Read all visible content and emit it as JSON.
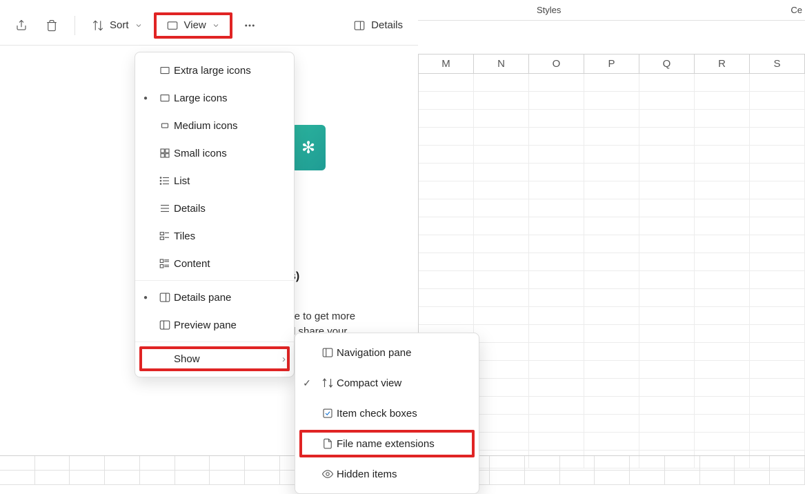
{
  "ribbon": {
    "styles_label": "Styles",
    "cells_label": "Ce"
  },
  "spreadsheet": {
    "columns": [
      "M",
      "N",
      "O",
      "P",
      "Q",
      "R",
      "S"
    ]
  },
  "toolbar": {
    "sort_label": "Sort",
    "view_label": "View",
    "details_label": "Details"
  },
  "background": {
    "filename_suffix": "s)",
    "hint_line1": "ile to get more",
    "hint_line2": "d share your"
  },
  "view_menu": {
    "items": [
      {
        "label": "Extra large icons",
        "icon": "rect",
        "selected": false
      },
      {
        "label": "Large icons",
        "icon": "rect",
        "selected": true
      },
      {
        "label": "Medium icons",
        "icon": "rect-sm",
        "selected": false
      },
      {
        "label": "Small icons",
        "icon": "grid4",
        "selected": false
      },
      {
        "label": "List",
        "icon": "list",
        "selected": false
      },
      {
        "label": "Details",
        "icon": "details",
        "selected": false
      },
      {
        "label": "Tiles",
        "icon": "tiles",
        "selected": false
      },
      {
        "label": "Content",
        "icon": "content",
        "selected": false
      }
    ],
    "panes": [
      {
        "label": "Details pane",
        "selected": true
      },
      {
        "label": "Preview pane",
        "selected": false
      }
    ],
    "show_label": "Show"
  },
  "show_menu": {
    "items": [
      {
        "label": "Navigation pane",
        "icon": "navpane",
        "checked": false,
        "highlight": false
      },
      {
        "label": "Compact view",
        "icon": "compact",
        "checked": true,
        "highlight": false
      },
      {
        "label": "Item check boxes",
        "icon": "checkbox",
        "checked": false,
        "highlight": false
      },
      {
        "label": "File name extensions",
        "icon": "file",
        "checked": false,
        "highlight": true
      },
      {
        "label": "Hidden items",
        "icon": "eye",
        "checked": false,
        "highlight": false
      }
    ]
  },
  "highlight_color": "#e02424"
}
